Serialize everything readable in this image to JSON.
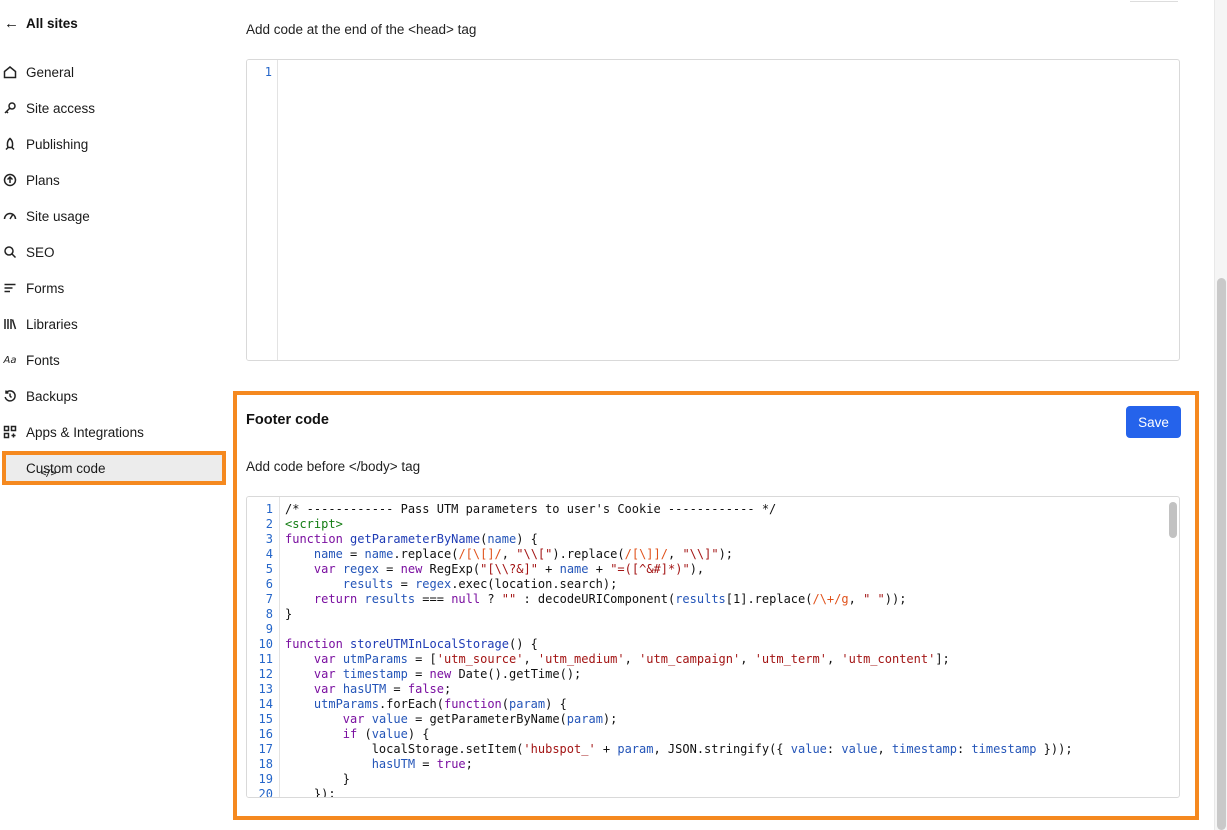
{
  "sidebar": {
    "back_label": "All sites",
    "items": [
      {
        "label": "General",
        "icon": "home-icon"
      },
      {
        "label": "Site access",
        "icon": "key-icon"
      },
      {
        "label": "Publishing",
        "icon": "rocket-icon"
      },
      {
        "label": "Plans",
        "icon": "upgrade-icon"
      },
      {
        "label": "Site usage",
        "icon": "gauge-icon"
      },
      {
        "label": "SEO",
        "icon": "search-icon"
      },
      {
        "label": "Forms",
        "icon": "lines-icon"
      },
      {
        "label": "Libraries",
        "icon": "library-icon"
      },
      {
        "label": "Fonts",
        "icon": "font-icon",
        "glyph": "Aa"
      },
      {
        "label": "Backups",
        "icon": "history-icon"
      },
      {
        "label": "Apps & Integrations",
        "icon": "apps-icon"
      },
      {
        "label": "Custom code",
        "icon": "code-icon",
        "glyph": "</>",
        "active": true
      }
    ]
  },
  "head_section": {
    "label": "Add code at the end of the <head> tag",
    "line_numbers": [
      "1"
    ]
  },
  "footer_section": {
    "title": "Footer code",
    "save_label": "Save",
    "label": "Add code before </body> tag",
    "line_numbers": [
      "1",
      "2",
      "3",
      "4",
      "5",
      "6",
      "7",
      "8",
      "9",
      "10",
      "11",
      "12",
      "13",
      "14",
      "15",
      "16",
      "17",
      "18",
      "19",
      "20"
    ],
    "code_lines": [
      "/* ------------ Pass UTM parameters to user's Cookie ------------ */",
      "<script>",
      "function getParameterByName(name) {",
      "    name = name.replace(/[\\[]/, \"\\\\[\").replace(/[\\]]/, \"\\\\]\");",
      "    var regex = new RegExp(\"[\\\\?&]\" + name + \"=([^&#]*)\"),",
      "        results = regex.exec(location.search);",
      "    return results === null ? \"\" : decodeURIComponent(results[1].replace(/\\+/g, \" \"));",
      "}",
      "",
      "function storeUTMInLocalStorage() {",
      "    var utmParams = ['utm_source', 'utm_medium', 'utm_campaign', 'utm_term', 'utm_content'];",
      "    var timestamp = new Date().getTime();",
      "    var hasUTM = false;",
      "    utmParams.forEach(function(param) {",
      "        var value = getParameterByName(param);",
      "        if (value) {",
      "            localStorage.setItem('hubspot_' + param, JSON.stringify({ value: value, timestamp: timestamp }));",
      "            hasUTM = true;",
      "        }",
      "    });"
    ]
  },
  "colors": {
    "accent": "#2563eb",
    "highlight": "#f5891f",
    "line_number": "#2566c9"
  }
}
